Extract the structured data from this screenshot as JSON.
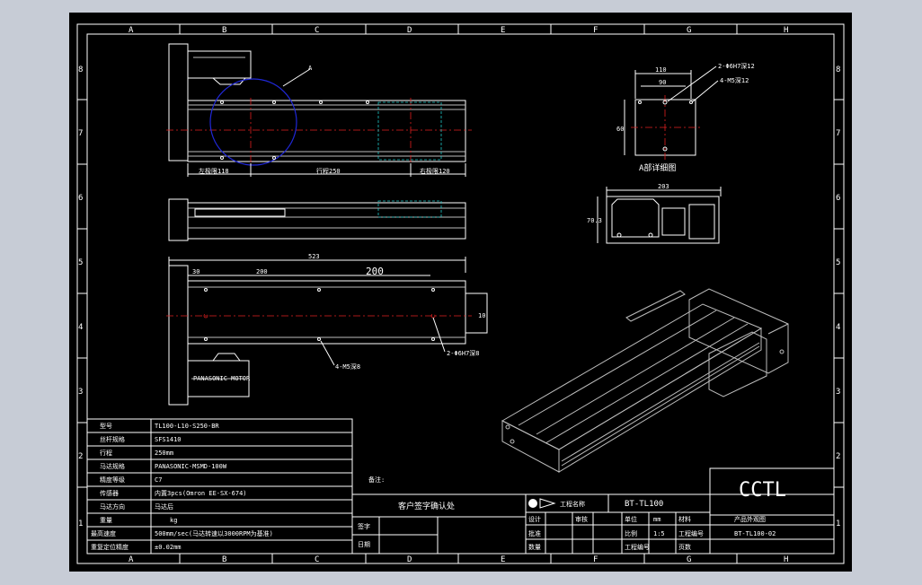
{
  "border": {
    "columns": [
      "A",
      "B",
      "C",
      "D",
      "E",
      "F",
      "G",
      "H"
    ],
    "rows": [
      "8",
      "7",
      "6",
      "5",
      "4",
      "3",
      "2",
      "1"
    ]
  },
  "top_view": {
    "label_a": "A",
    "dim_left": "左极限118",
    "dim_mid": "行程250",
    "dim_right": "右极限120"
  },
  "bottom_view": {
    "dim_total": "523",
    "dim_a": "30",
    "dim_b": "200",
    "dim_c": "200",
    "dim_side": "10",
    "hole_left": "4-M5深8",
    "hole_right": "2-Φ6H7深8"
  },
  "detail_a": {
    "dim_width": "110",
    "dim_inner": "90",
    "dim_height": "60",
    "note_1": "2-Φ6H7深12",
    "note_2": "4-M5深12",
    "caption": "A部详细图"
  },
  "end_view": {
    "dim_width": "203",
    "dim_height": "70.3"
  },
  "motor_label": "PANASONIC MOTOR",
  "spec_table": {
    "rows": [
      {
        "label": "型号",
        "value": "TL100-L10-S250-BR"
      },
      {
        "label": "丝杆规格",
        "value": "SFS1410"
      },
      {
        "label": "行程",
        "value": "250mm"
      },
      {
        "label": "马达规格",
        "value": "PANASONIC-MSMD-100W"
      },
      {
        "label": "精度等级",
        "value": "C7"
      },
      {
        "label": "传感器",
        "value": "内置3pcs(Omron EE-SX-674)"
      },
      {
        "label": "马达方向",
        "value": "马达后"
      },
      {
        "label": "重量",
        "value": "kg"
      },
      {
        "label": "最高速度",
        "value": "500mm/sec(马达转速以3000RPM为基准)"
      },
      {
        "label": "重复定位精度",
        "value": "±0.02mm"
      }
    ]
  },
  "remarks_label": "备注:",
  "confirm": {
    "title": "客户签字确认处",
    "sign_label": "签字",
    "date_label": "日期"
  },
  "title_block": {
    "project_label": "工程名称",
    "project_value": "BT-TL100",
    "company": "CCTL",
    "design_label": "设计",
    "check_label": "审核",
    "approve_label": "批准",
    "scale_label": "比例",
    "scale_value": "1:5",
    "drawing_no_label": "工程编号",
    "unit_label": "单位",
    "unit_value": "mm",
    "material_label": "材料",
    "product_name": "产品外观图",
    "drawing_no": "BT-TL100-02",
    "qty_label": "数量",
    "date_label": "工程编号",
    "sheet_label": "页数"
  }
}
